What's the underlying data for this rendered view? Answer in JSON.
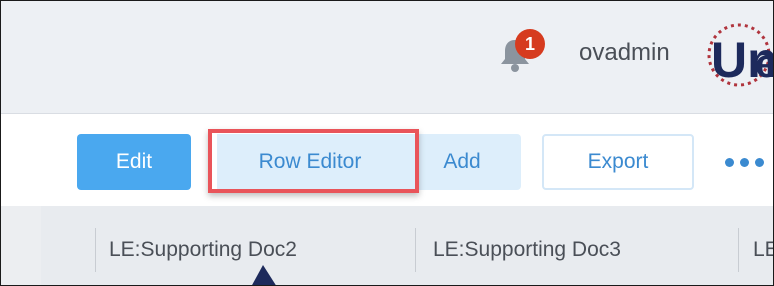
{
  "header": {
    "notification_count": "1",
    "username": "ovadmin",
    "logo_icon": "onestream-logo"
  },
  "toolbar": {
    "edit_label": "Edit",
    "row_editor_label": "Row Editor",
    "add_label": "Add",
    "export_label": "Export",
    "more_icon": "more-dots-icon"
  },
  "columns": [
    "LE:Supporting Doc2",
    "LE:Supporting Doc3",
    "LE"
  ],
  "colors": {
    "accent": "#4aa8ef",
    "highlight": "#e9545a",
    "badge": "#d63b1f"
  }
}
